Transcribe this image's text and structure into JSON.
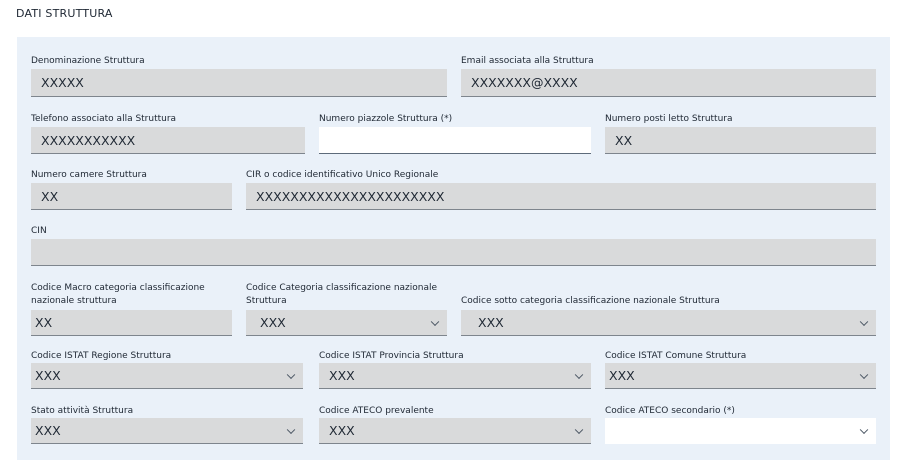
{
  "section": {
    "title": "DATI STRUTTURA"
  },
  "fields": {
    "denominazione": {
      "label": "Denominazione Struttura",
      "value": "XXXXX"
    },
    "email": {
      "label": "Email associata alla Struttura",
      "value": "XXXXXXX@XXXX"
    },
    "telefono": {
      "label": "Telefono associato alla Struttura",
      "value": "XXXXXXXXXXX"
    },
    "piazzole": {
      "label": "Numero piazzole Struttura (*)",
      "value": ""
    },
    "posti_letto": {
      "label": "Numero posti letto Struttura",
      "value": "XX"
    },
    "camere": {
      "label": "Numero camere Struttura",
      "value": "XX"
    },
    "cir": {
      "label": "CIR o codice identificativo Unico Regionale",
      "value": "XXXXXXXXXXXXXXXXXXXXXX"
    },
    "cin": {
      "label": "CIN",
      "value": ""
    },
    "macro_categoria": {
      "label_line1": "Codice Macro categoria classificazione",
      "label_line2": "nazionale struttura",
      "value": "XX"
    },
    "categoria": {
      "label_line1": "Codice Categoria classificazione nazionale",
      "label_line2": "Struttura",
      "value": "XXX"
    },
    "sotto_categoria": {
      "label": "Codice sotto categoria classificazione nazionale Struttura",
      "value": "XXX"
    },
    "istat_regione": {
      "label": "Codice ISTAT Regione Struttura",
      "value": "XXX"
    },
    "istat_provincia": {
      "label": "Codice ISTAT Provincia Struttura",
      "value": "XXX"
    },
    "istat_comune": {
      "label": "Codice ISTAT Comune Struttura",
      "value": "XXX"
    },
    "stato_attivita": {
      "label": "Stato attività Struttura",
      "value": "XXX"
    },
    "ateco_prevalente": {
      "label": "Codice ATECO prevalente",
      "value": "XXX"
    },
    "ateco_secondario": {
      "label": "Codice ATECO secondario (*)",
      "value": ""
    }
  },
  "colors": {
    "panel_bg": "#eaf1f9",
    "readonly_field_bg": "#d9dadb",
    "editable_field_bg": "#ffffff",
    "text": "#1e2733"
  },
  "icons": {
    "select_arrow": "chevron-down-icon"
  }
}
